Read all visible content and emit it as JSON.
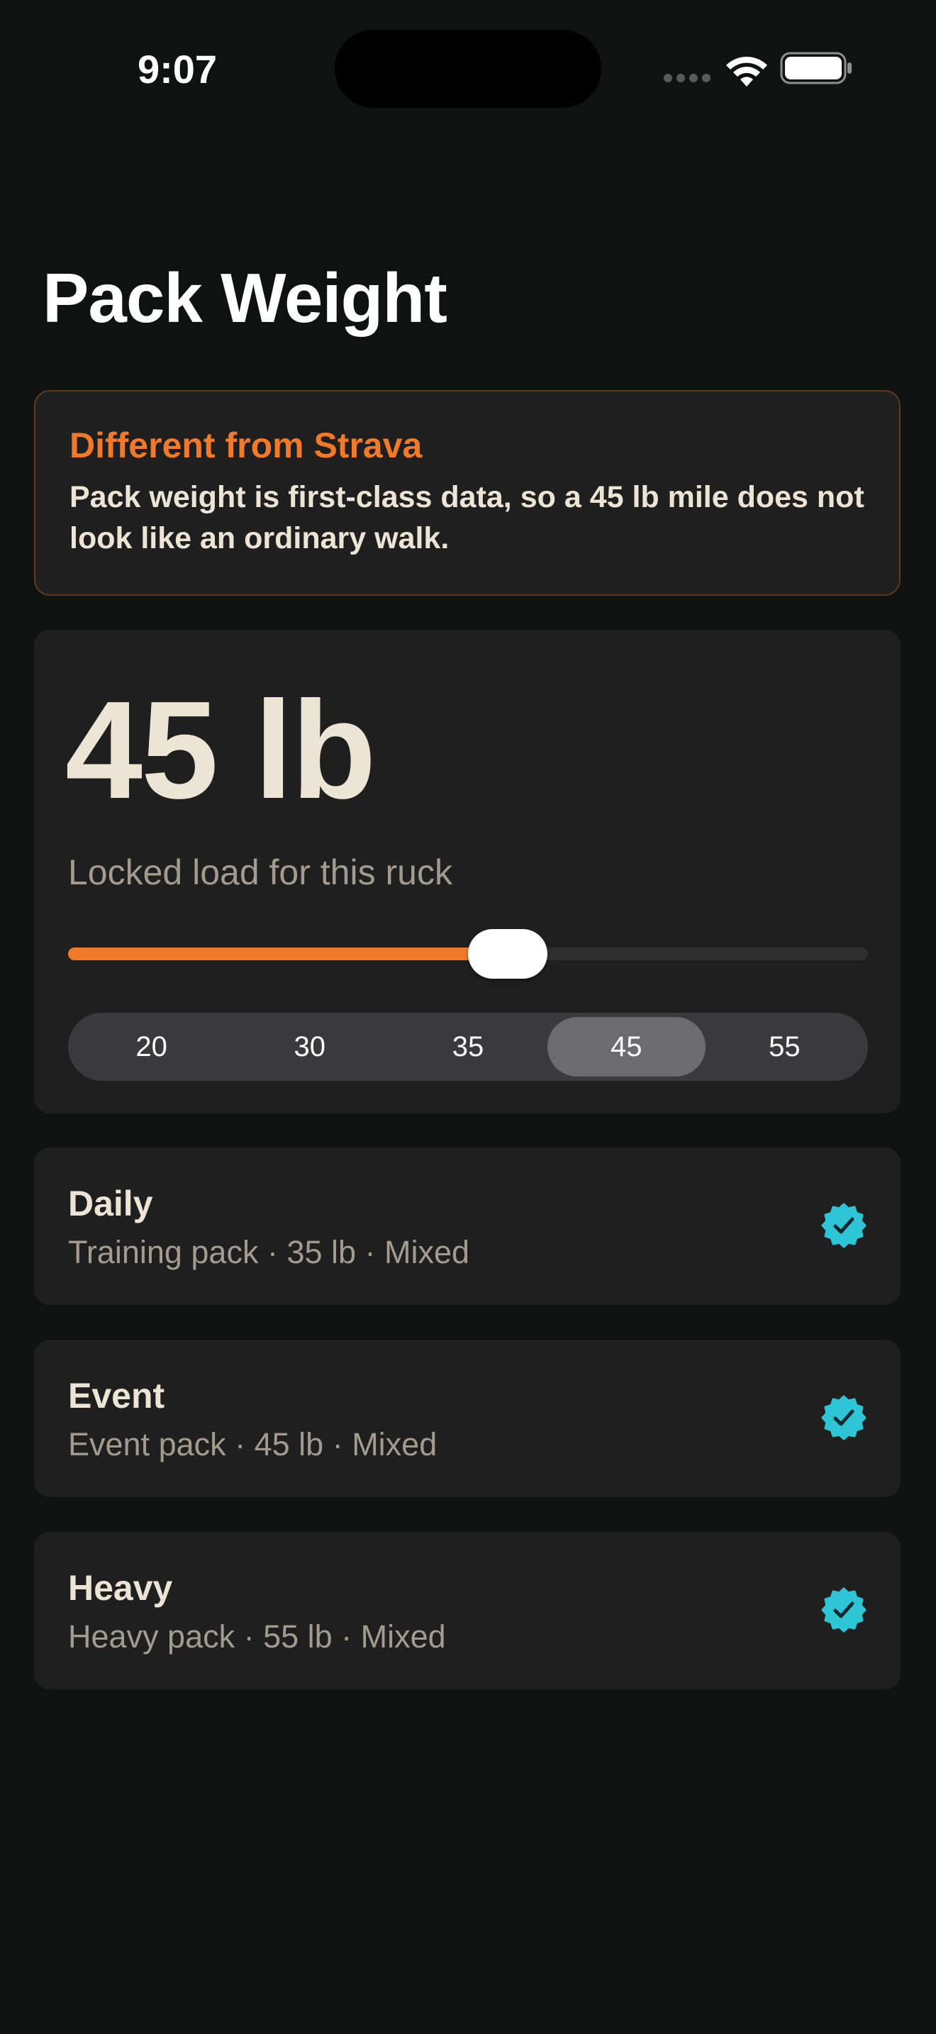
{
  "status_bar": {
    "time": "9:07",
    "icons": [
      "signal-icon",
      "wifi-icon",
      "battery-icon"
    ]
  },
  "page": {
    "title": "Pack Weight"
  },
  "callout": {
    "title": "Different from Strava",
    "body": "Pack weight is first-class data, so a 45 lb mile does not look like an ordinary walk."
  },
  "weight": {
    "value_label": "45 lb",
    "caption": "Locked load for this ruck",
    "slider_fraction": 0.55,
    "presets": [
      "20",
      "30",
      "35",
      "45",
      "55"
    ],
    "selected_preset": "45"
  },
  "packs": [
    {
      "name": "Daily",
      "detail": "Training pack · 35 lb · Mixed",
      "icon": "verified-check-icon"
    },
    {
      "name": "Event",
      "detail": "Event pack · 45 lb · Mixed",
      "icon": "verified-check-icon"
    },
    {
      "name": "Heavy",
      "detail": "Heavy pack · 55 lb · Mixed",
      "icon": "verified-check-icon"
    }
  ],
  "colors": {
    "background": "#101111",
    "card": "#1f1f1f",
    "accent_orange": "#f07a2a",
    "check_cyan": "#2ec5d6",
    "text_primary": "#ece4d4",
    "text_secondary": "#a39c8e"
  }
}
